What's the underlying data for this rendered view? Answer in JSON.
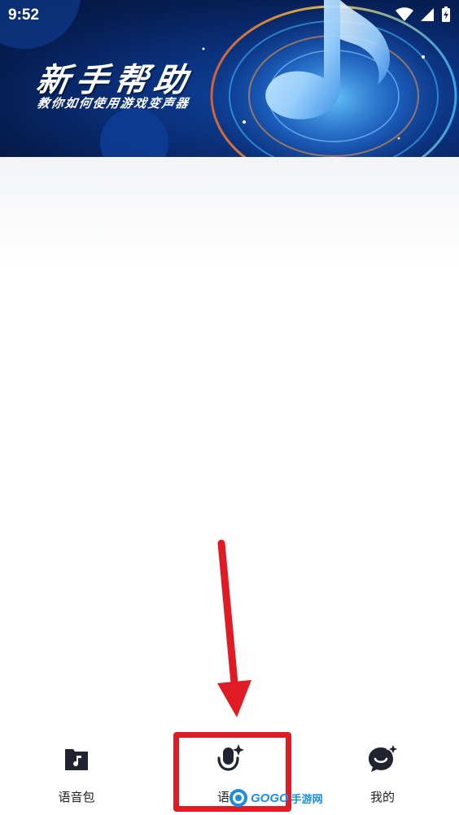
{
  "status_bar": {
    "time": "9:52",
    "icons": [
      "wifi-icon",
      "signal-icon",
      "battery-charging-icon"
    ]
  },
  "banner": {
    "title": "新手帮助",
    "subtitle": "教你如何使用游戏变声器"
  },
  "bottom_nav": {
    "items": [
      {
        "label": "语音包",
        "icon": "music-folder-icon",
        "active": false
      },
      {
        "label": "语音",
        "icon": "microphone-sparkle-icon",
        "active": true
      },
      {
        "label": "我的",
        "icon": "chat-sparkle-icon",
        "active": false
      }
    ]
  },
  "annotation": {
    "arrow_color": "#e01b24",
    "highlight_color": "#e01b24"
  },
  "watermark": {
    "text": "GOGO",
    "suffix": "手游网"
  },
  "colors": {
    "banner_dark": "#071f55",
    "banner_accent": "#1b6fd8",
    "nav_icon": "#1f2430"
  }
}
